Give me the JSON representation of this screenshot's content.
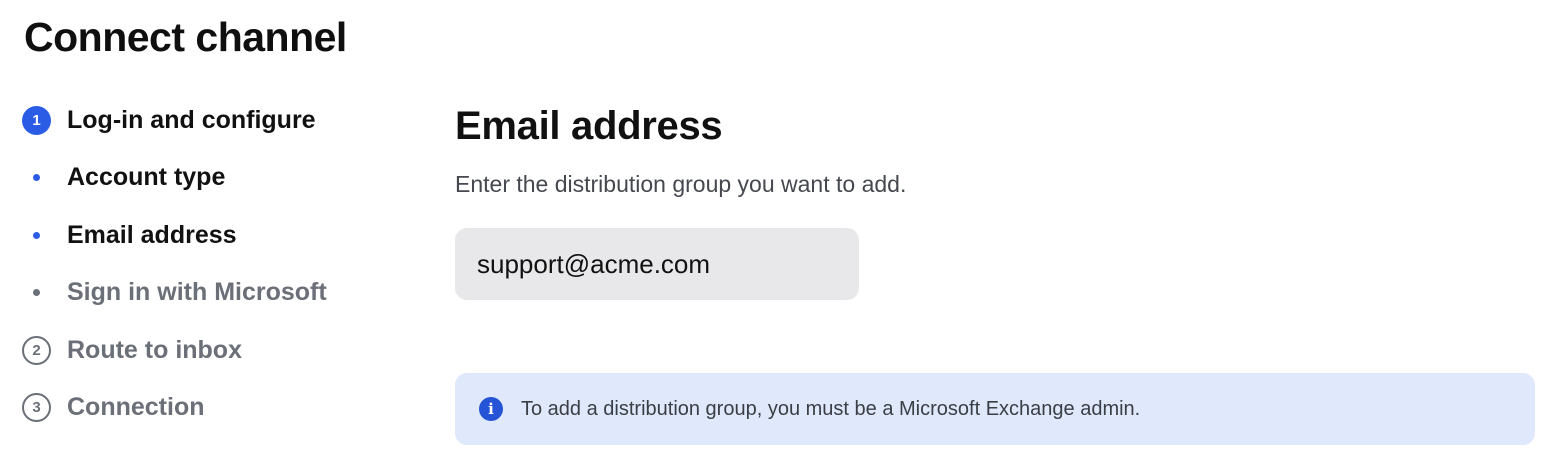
{
  "header": {
    "title": "Connect channel"
  },
  "stepper": {
    "steps": [
      {
        "marker": "1",
        "label": "Log-in and configure"
      },
      {
        "marker": "",
        "label": "Account type"
      },
      {
        "marker": "",
        "label": "Email address"
      },
      {
        "marker": "",
        "label": "Sign in with Microsoft"
      },
      {
        "marker": "2",
        "label": "Route to inbox"
      },
      {
        "marker": "3",
        "label": "Connection"
      }
    ]
  },
  "main": {
    "heading": "Email address",
    "description": "Enter the distribution group you want to add.",
    "email_input": {
      "value": "support@acme.com"
    },
    "info_banner": {
      "icon": "info-icon",
      "text": "To add a distribution group, you must be a Microsoft Exchange admin."
    }
  },
  "colors": {
    "accent": "#2b5ce6",
    "muted": "#6b6f78",
    "input_bg": "#e8e8ea",
    "info_bg": "#dfe9fb"
  }
}
